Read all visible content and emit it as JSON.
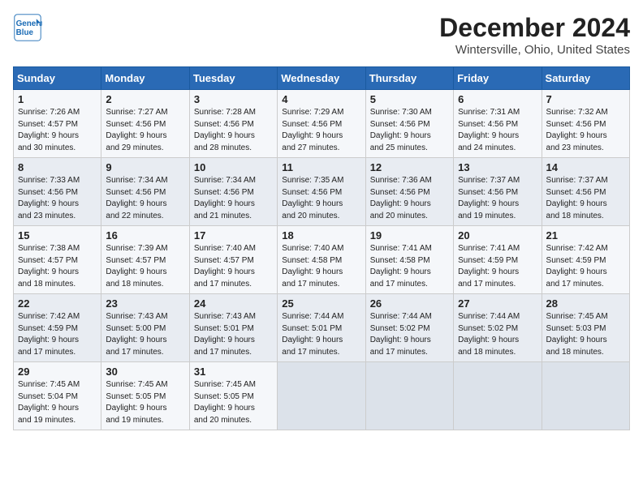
{
  "logo": {
    "line1": "General",
    "line2": "Blue"
  },
  "title": "December 2024",
  "subtitle": "Wintersville, Ohio, United States",
  "weekdays": [
    "Sunday",
    "Monday",
    "Tuesday",
    "Wednesday",
    "Thursday",
    "Friday",
    "Saturday"
  ],
  "weeks": [
    [
      {
        "day": 1,
        "info": "Sunrise: 7:26 AM\nSunset: 4:57 PM\nDaylight: 9 hours\nand 30 minutes."
      },
      {
        "day": 2,
        "info": "Sunrise: 7:27 AM\nSunset: 4:56 PM\nDaylight: 9 hours\nand 29 minutes."
      },
      {
        "day": 3,
        "info": "Sunrise: 7:28 AM\nSunset: 4:56 PM\nDaylight: 9 hours\nand 28 minutes."
      },
      {
        "day": 4,
        "info": "Sunrise: 7:29 AM\nSunset: 4:56 PM\nDaylight: 9 hours\nand 27 minutes."
      },
      {
        "day": 5,
        "info": "Sunrise: 7:30 AM\nSunset: 4:56 PM\nDaylight: 9 hours\nand 25 minutes."
      },
      {
        "day": 6,
        "info": "Sunrise: 7:31 AM\nSunset: 4:56 PM\nDaylight: 9 hours\nand 24 minutes."
      },
      {
        "day": 7,
        "info": "Sunrise: 7:32 AM\nSunset: 4:56 PM\nDaylight: 9 hours\nand 23 minutes."
      }
    ],
    [
      {
        "day": 8,
        "info": "Sunrise: 7:33 AM\nSunset: 4:56 PM\nDaylight: 9 hours\nand 23 minutes."
      },
      {
        "day": 9,
        "info": "Sunrise: 7:34 AM\nSunset: 4:56 PM\nDaylight: 9 hours\nand 22 minutes."
      },
      {
        "day": 10,
        "info": "Sunrise: 7:34 AM\nSunset: 4:56 PM\nDaylight: 9 hours\nand 21 minutes."
      },
      {
        "day": 11,
        "info": "Sunrise: 7:35 AM\nSunset: 4:56 PM\nDaylight: 9 hours\nand 20 minutes."
      },
      {
        "day": 12,
        "info": "Sunrise: 7:36 AM\nSunset: 4:56 PM\nDaylight: 9 hours\nand 20 minutes."
      },
      {
        "day": 13,
        "info": "Sunrise: 7:37 AM\nSunset: 4:56 PM\nDaylight: 9 hours\nand 19 minutes."
      },
      {
        "day": 14,
        "info": "Sunrise: 7:37 AM\nSunset: 4:56 PM\nDaylight: 9 hours\nand 18 minutes."
      }
    ],
    [
      {
        "day": 15,
        "info": "Sunrise: 7:38 AM\nSunset: 4:57 PM\nDaylight: 9 hours\nand 18 minutes."
      },
      {
        "day": 16,
        "info": "Sunrise: 7:39 AM\nSunset: 4:57 PM\nDaylight: 9 hours\nand 18 minutes."
      },
      {
        "day": 17,
        "info": "Sunrise: 7:40 AM\nSunset: 4:57 PM\nDaylight: 9 hours\nand 17 minutes."
      },
      {
        "day": 18,
        "info": "Sunrise: 7:40 AM\nSunset: 4:58 PM\nDaylight: 9 hours\nand 17 minutes."
      },
      {
        "day": 19,
        "info": "Sunrise: 7:41 AM\nSunset: 4:58 PM\nDaylight: 9 hours\nand 17 minutes."
      },
      {
        "day": 20,
        "info": "Sunrise: 7:41 AM\nSunset: 4:59 PM\nDaylight: 9 hours\nand 17 minutes."
      },
      {
        "day": 21,
        "info": "Sunrise: 7:42 AM\nSunset: 4:59 PM\nDaylight: 9 hours\nand 17 minutes."
      }
    ],
    [
      {
        "day": 22,
        "info": "Sunrise: 7:42 AM\nSunset: 4:59 PM\nDaylight: 9 hours\nand 17 minutes."
      },
      {
        "day": 23,
        "info": "Sunrise: 7:43 AM\nSunset: 5:00 PM\nDaylight: 9 hours\nand 17 minutes."
      },
      {
        "day": 24,
        "info": "Sunrise: 7:43 AM\nSunset: 5:01 PM\nDaylight: 9 hours\nand 17 minutes."
      },
      {
        "day": 25,
        "info": "Sunrise: 7:44 AM\nSunset: 5:01 PM\nDaylight: 9 hours\nand 17 minutes."
      },
      {
        "day": 26,
        "info": "Sunrise: 7:44 AM\nSunset: 5:02 PM\nDaylight: 9 hours\nand 17 minutes."
      },
      {
        "day": 27,
        "info": "Sunrise: 7:44 AM\nSunset: 5:02 PM\nDaylight: 9 hours\nand 18 minutes."
      },
      {
        "day": 28,
        "info": "Sunrise: 7:45 AM\nSunset: 5:03 PM\nDaylight: 9 hours\nand 18 minutes."
      }
    ],
    [
      {
        "day": 29,
        "info": "Sunrise: 7:45 AM\nSunset: 5:04 PM\nDaylight: 9 hours\nand 19 minutes."
      },
      {
        "day": 30,
        "info": "Sunrise: 7:45 AM\nSunset: 5:05 PM\nDaylight: 9 hours\nand 19 minutes."
      },
      {
        "day": 31,
        "info": "Sunrise: 7:45 AM\nSunset: 5:05 PM\nDaylight: 9 hours\nand 20 minutes."
      },
      null,
      null,
      null,
      null
    ]
  ]
}
